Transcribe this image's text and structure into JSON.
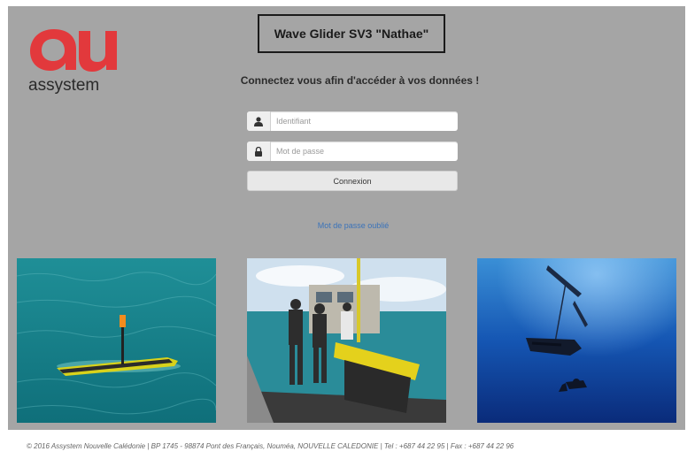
{
  "header": {
    "logo_text": "assystem",
    "title": "Wave Glider SV3 \"Nathae\""
  },
  "login": {
    "prompt": "Connectez vous afin d'accéder à vos données !",
    "username_placeholder": "Identifiant",
    "username_icon": "user-icon",
    "password_placeholder": "Mot de passe",
    "password_icon": "lock-icon",
    "submit_label": "Connexion",
    "forgot_label": "Mot de passe oublié"
  },
  "photos": [
    {
      "name": "glider-at-sea-photo"
    },
    {
      "name": "boat-deck-crew-photo"
    },
    {
      "name": "underwater-divers-photo"
    }
  ],
  "colors": {
    "panel_bg": "#a5a5a5",
    "brand_red": "#e2393c",
    "link_blue": "#3b73b9"
  },
  "footer": {
    "text": "© 2016 Assystem Nouvelle Calédonie | BP 1745 - 98874 Pont des Français, Nouméa, NOUVELLE CALEDONIE | Tel : +687 44 22 95 | Fax : +687 44 22 96"
  }
}
